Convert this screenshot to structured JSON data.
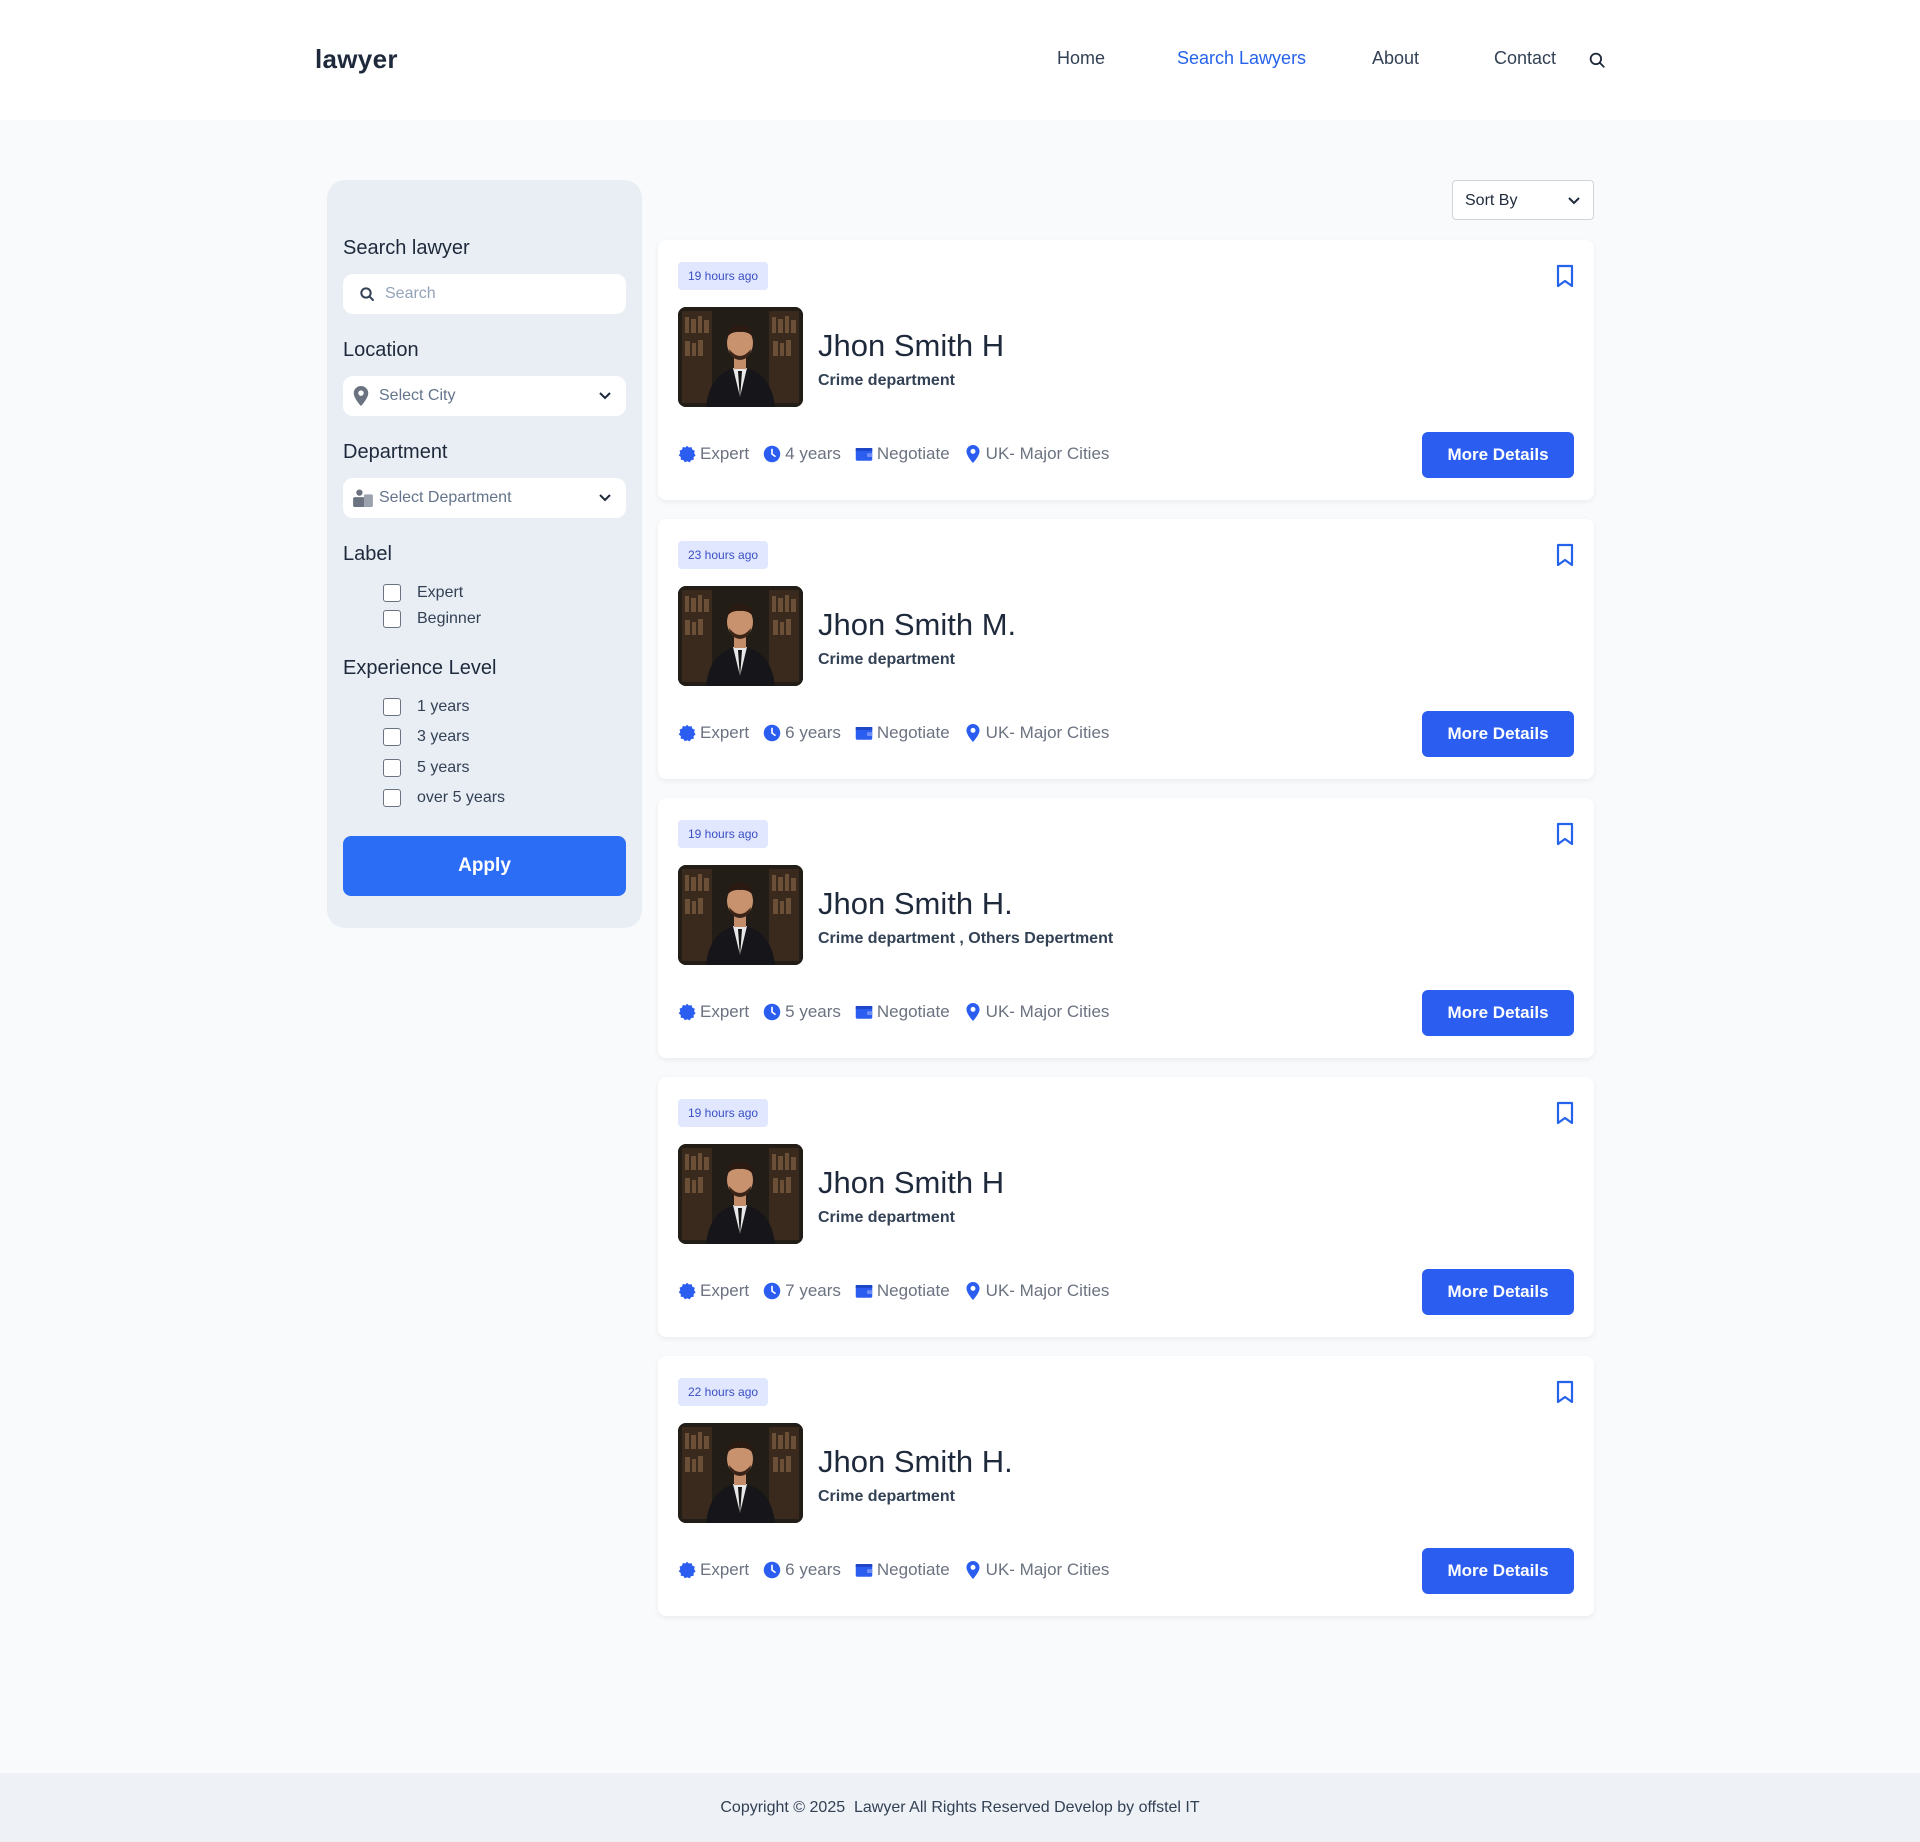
{
  "header": {
    "logo": "lawyer",
    "nav": [
      {
        "label": "Home",
        "active": false
      },
      {
        "label": "Search Lawyers",
        "active": true
      },
      {
        "label": "About",
        "active": false
      },
      {
        "label": "Contact",
        "active": false
      }
    ],
    "search_icon": "search-icon"
  },
  "sidebar": {
    "search_heading": "Search lawyer",
    "search_placeholder": "Search",
    "location_heading": "Location",
    "location_value": "Select City",
    "department_heading": "Department",
    "department_value": "Select Department",
    "label_heading": "Label",
    "labels": [
      "Expert",
      "Beginner"
    ],
    "experience_heading": "Experience Level",
    "experience": [
      "1 years",
      "3 years",
      "5 years",
      "over 5 years"
    ],
    "apply_label": "Apply"
  },
  "sort": {
    "label": "Sort By"
  },
  "lawyers": [
    {
      "time": "19 hours ago",
      "name": "Jhon Smith H",
      "department": "Crime department",
      "level": "Expert",
      "experience": "4 years",
      "fee": "Negotiate",
      "location": "UK- Major Cities",
      "button": "More Details"
    },
    {
      "time": "23 hours ago",
      "name": "Jhon Smith M.",
      "department": "Crime department",
      "level": "Expert",
      "experience": "6 years",
      "fee": "Negotiate",
      "location": "UK- Major Cities",
      "button": "More Details"
    },
    {
      "time": "19 hours ago",
      "name": "Jhon Smith H.",
      "department": "Crime department , Others Depertment",
      "level": "Expert",
      "experience": "5 years",
      "fee": "Negotiate",
      "location": "UK- Major Cities",
      "button": "More Details"
    },
    {
      "time": "19 hours ago",
      "name": "Jhon Smith H",
      "department": "Crime department",
      "level": "Expert",
      "experience": "7 years",
      "fee": "Negotiate",
      "location": "UK- Major Cities",
      "button": "More Details"
    },
    {
      "time": "22 hours ago",
      "name": "Jhon Smith H.",
      "department": "Crime department",
      "level": "Expert",
      "experience": "6 years",
      "fee": "Negotiate",
      "location": "UK- Major Cities",
      "button": "More Details"
    }
  ],
  "footer": {
    "text": "Copyright © 2025  Lawyer All Rights Reserved Develop by offstel IT"
  },
  "colors": {
    "accent": "#2563eb",
    "button": "#2b5ef0",
    "badge_bg": "#e0e7ff",
    "sidebar_bg": "#e9eef4"
  }
}
